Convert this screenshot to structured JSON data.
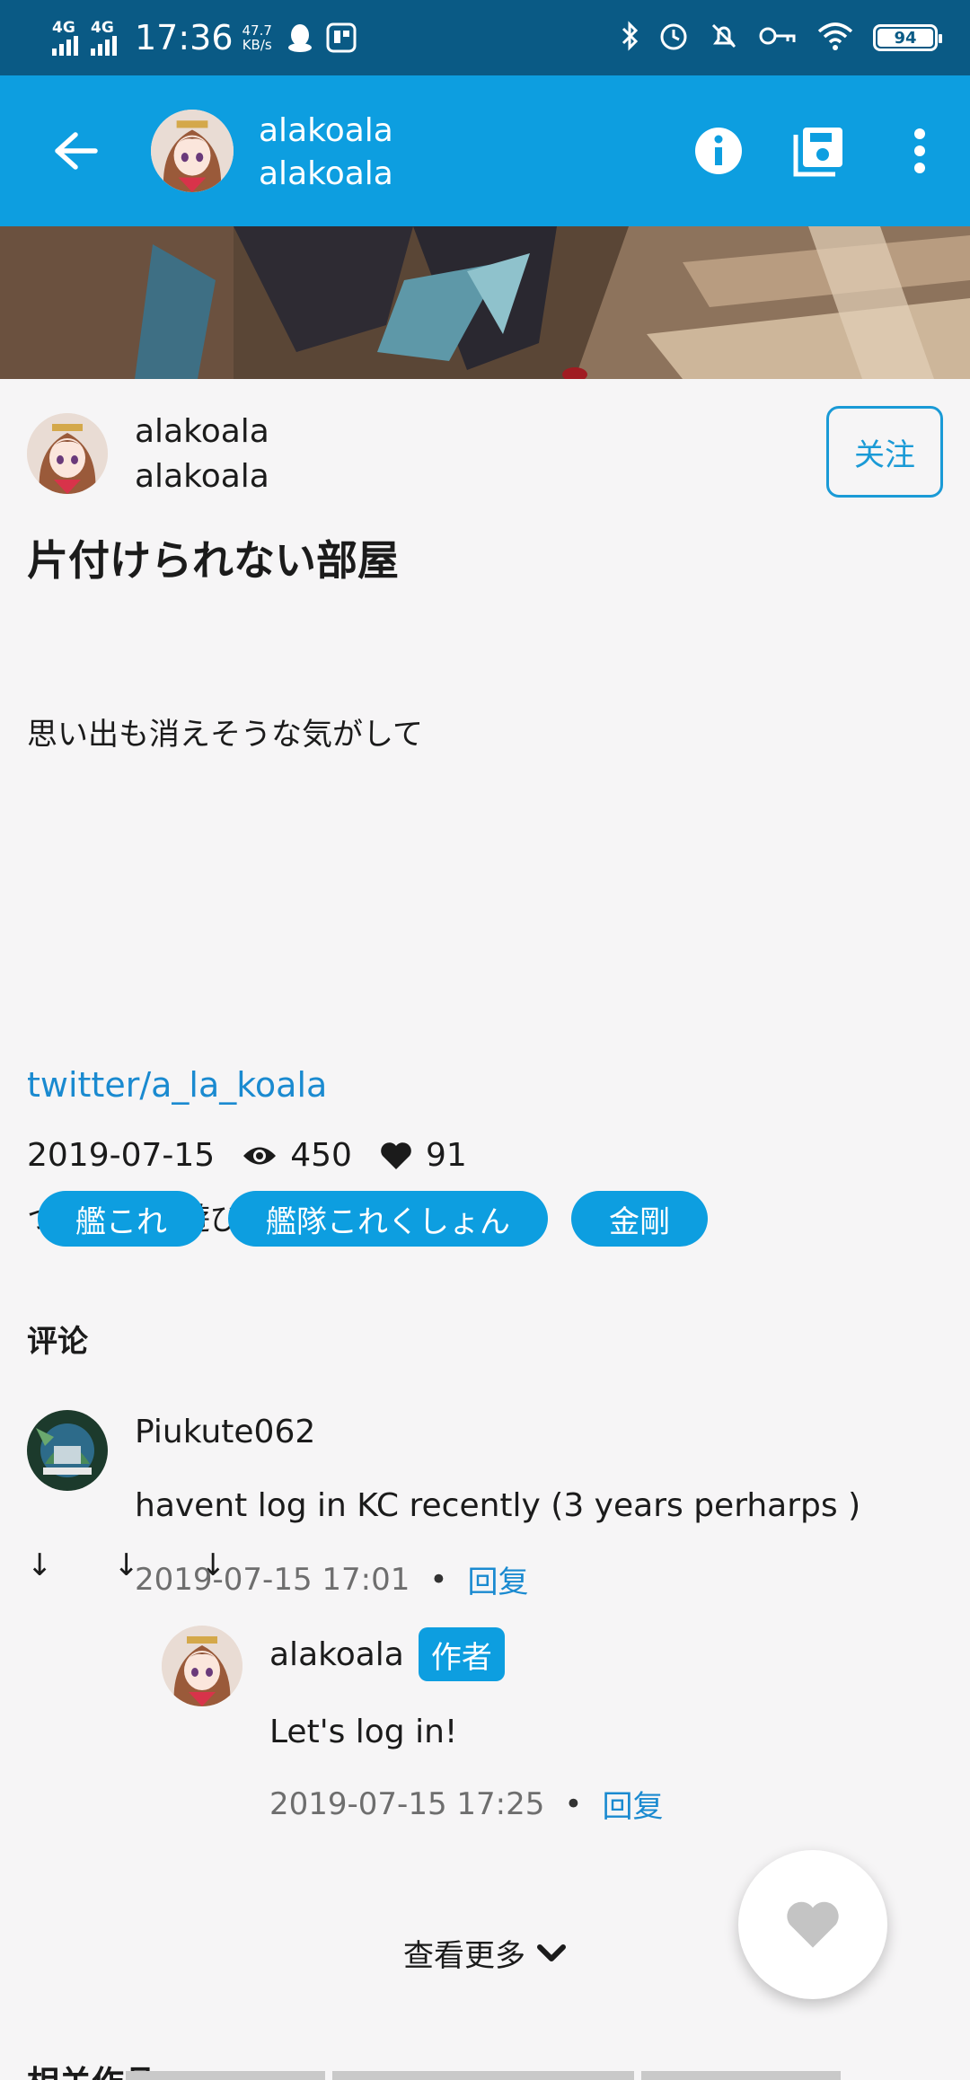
{
  "status_bar": {
    "network_1": "4G",
    "network_2": "4G",
    "time": "17:36",
    "speed_value": "47.7",
    "speed_unit": "KB/s",
    "battery": "94"
  },
  "app_bar": {
    "title": "alakoala",
    "subtitle": "alakoala"
  },
  "author": {
    "name": "alakoala",
    "account": "alakoala",
    "follow_label": "关注"
  },
  "illustration": {
    "title": "片付けられない部屋",
    "caption_lines": [
      "思い出も消えそうな気がして",
      "",
      "",
      "ついったも遊びに来てください！！",
      "",
      "↓　　↓　　↓"
    ],
    "link": "twitter/a_la_koala",
    "date": "2019-07-15",
    "views": "450",
    "likes": "91",
    "tags": [
      "艦これ",
      "艦隊これくしょん",
      "金剛"
    ]
  },
  "comments_section": {
    "title": "评论",
    "comments": [
      {
        "user": "Piukute062",
        "text": "havent log in KC recently (3 years perharps )",
        "time": "2019-07-15 17:01",
        "reply_label": "回复"
      }
    ],
    "reply": {
      "user": "alakoala",
      "badge": "作者",
      "text": "Let's log in!",
      "time": "2019-07-15 17:25",
      "reply_label": "回复"
    },
    "more_label": "查看更多"
  },
  "related": {
    "title": "相关作品"
  },
  "colors": {
    "status_bar": "#0a5a85",
    "app_bar": "#0d9ee0",
    "accent": "#1a9ad6",
    "background": "#f6f5f6"
  }
}
